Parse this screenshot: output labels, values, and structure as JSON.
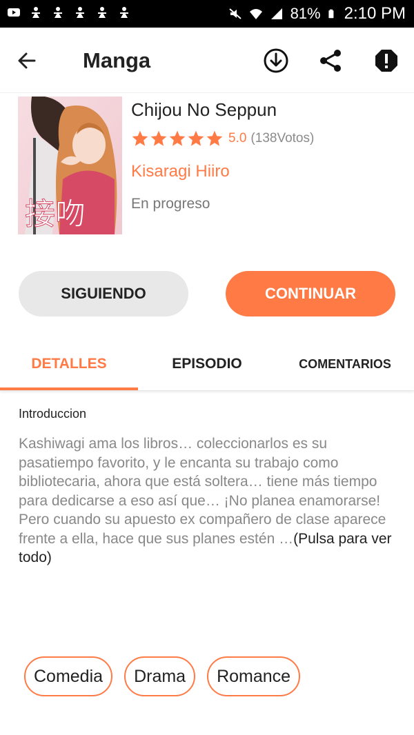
{
  "status_bar": {
    "battery": "81%",
    "time": "2:10 PM"
  },
  "app_bar": {
    "title": "Manga"
  },
  "manga": {
    "title": "Chijou No Seppun",
    "rating_stars": 5,
    "score": "5.0",
    "votes": "(138Votos)",
    "author": "Kisaragi Hiiro",
    "status": "En progreso",
    "cover_text": "接吻"
  },
  "actions": {
    "follow_label": "SIGUIENDO",
    "continue_label": "CONTINUAR"
  },
  "tabs": [
    {
      "label": "DETALLES",
      "active": true
    },
    {
      "label": "EPISODIO",
      "active": false
    },
    {
      "label": "COMENTARIOS",
      "active": false
    }
  ],
  "details": {
    "intro_label": "Introduccion",
    "intro_text": "Kashiwagi ama los libros… coleccionarlos es su pasatiempo favorito, y le encanta su trabajo como bibliotecaria, ahora que está soltera… tiene más tiempo para dedicarse a eso así que… ¡No planea enamorarse! Pero cuando su apuesto ex compañero de clase aparece frente a ella, hace que sus planes estén …",
    "more_label": "(Pulsa para ver todo)"
  },
  "genres": [
    "Comedia",
    "Drama",
    "Romance"
  ],
  "colors": {
    "accent": "#ff7a45",
    "follow_bg": "#e8e8e8",
    "status_bar": "#000000"
  }
}
